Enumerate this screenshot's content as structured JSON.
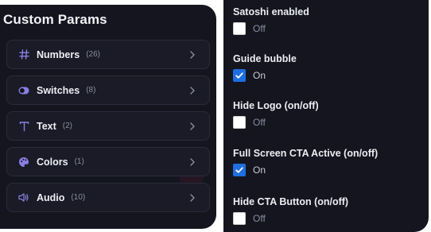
{
  "left_panel": {
    "title": "Custom Params",
    "categories": [
      {
        "label": "Numbers",
        "count": "(26)",
        "icon": "hash-icon"
      },
      {
        "label": "Switches",
        "count": "(8)",
        "icon": "toggle-icon"
      },
      {
        "label": "Text",
        "count": "(2)",
        "icon": "text-t-icon"
      },
      {
        "label": "Colors",
        "count": "(1)",
        "icon": "palette-icon"
      },
      {
        "label": "Audio",
        "count": "(10)",
        "icon": "speaker-icon"
      }
    ]
  },
  "right_panel": {
    "settings": [
      {
        "label": "Satoshi enabled",
        "checked": false,
        "state": "Off"
      },
      {
        "label": "Guide bubble",
        "checked": true,
        "state": "On"
      },
      {
        "label": "Hide Logo (on/off)",
        "checked": false,
        "state": "Off"
      },
      {
        "label": "Full Screen CTA Active (on/off)",
        "checked": true,
        "state": "On"
      },
      {
        "label": "Hide CTA Button (on/off)",
        "checked": false,
        "state": "Off"
      }
    ]
  },
  "colors": {
    "panel_bg": "#14151f",
    "accent_purple": "#8b7fe0",
    "checkbox_on": "#1e6fe0"
  }
}
